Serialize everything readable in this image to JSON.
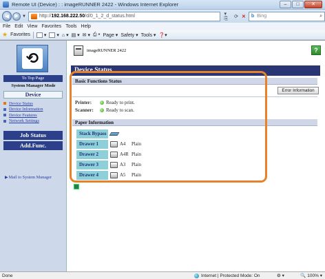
{
  "window": {
    "title": "Remote UI (Device) : : imageRUNNER 2422 - Windows Internet Explorer",
    "minimize": "–",
    "maximize": "□",
    "close": "✕"
  },
  "address_bar": {
    "url_prefix": "http://",
    "url_host": "192.168.222.50",
    "url_path": "/d/0_1_2_d_status.html",
    "search_engine": "Bing"
  },
  "menu": [
    "File",
    "Edit",
    "View",
    "Favorites",
    "Tools",
    "Help"
  ],
  "favorites_bar": {
    "favorites_label": "Favorites",
    "page_label": "Page ▾",
    "safety_label": "Safety ▾",
    "tools_label": "Tools ▾"
  },
  "sidebar": {
    "to_top": "To Top Page",
    "mode": "System Manager Mode",
    "device_tab": "Device",
    "device_links": [
      {
        "label": "Device Status"
      },
      {
        "label": "Device Information"
      },
      {
        "label": "Device Features"
      },
      {
        "label": "Network Settings"
      }
    ],
    "job_status": "Job Status",
    "add_func": "Add.Func.",
    "mail_link": "Mail to System Manager"
  },
  "main": {
    "model": "imageRUNNER 2422",
    "help": "?",
    "page_title": "Device Status",
    "basic_title": "Basic Functions Status",
    "error_button": "Error Information",
    "status": [
      {
        "label": "Printer:",
        "value": "Ready to print."
      },
      {
        "label": "Scanner:",
        "value": "Ready to scan."
      }
    ],
    "paper_title": "Paper Information",
    "paper": [
      {
        "name": "Stack Bypass",
        "size": "",
        "type": ""
      },
      {
        "name": "Drawer 1",
        "size": "A4",
        "type": "Plain"
      },
      {
        "name": "Drawer 2",
        "size": "A4R",
        "type": "Plain"
      },
      {
        "name": "Drawer 3",
        "size": "A3",
        "type": "Plain"
      },
      {
        "name": "Drawer 4",
        "size": "A5",
        "type": "Plain"
      }
    ]
  },
  "statusbar": {
    "left": "Done",
    "zone": "Internet | Protected Mode: On",
    "zoom": "100%"
  },
  "colors": {
    "highlight": "#e8822a",
    "page_bar": "#2a3573",
    "sidebar_button": "#2b3f8a",
    "paper_cell": "#8dd0da"
  }
}
